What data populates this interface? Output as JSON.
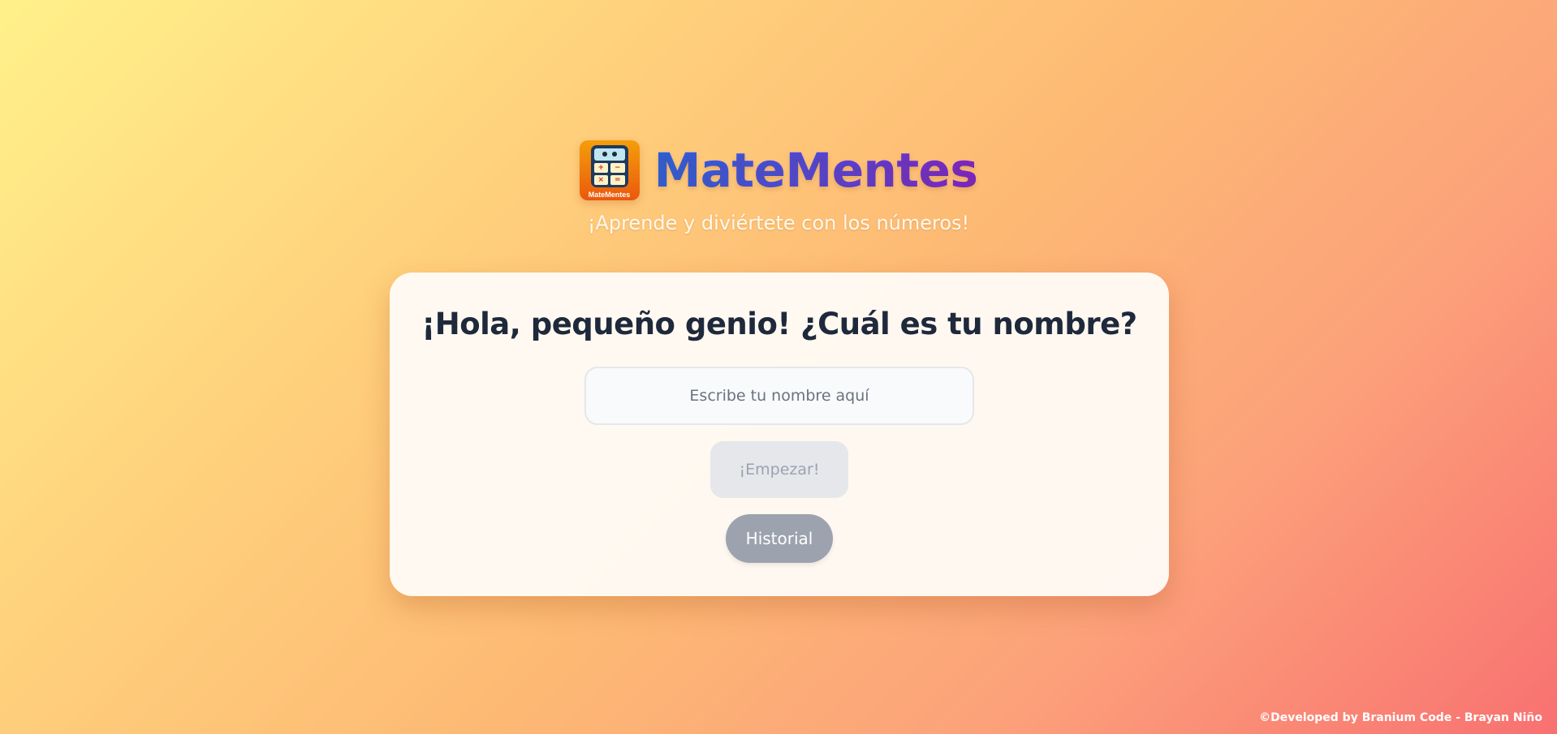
{
  "header": {
    "logo": {
      "icon": "calculator-mascot-icon",
      "caption": "MateMentes",
      "keys": [
        "+",
        "−",
        "×",
        "="
      ]
    },
    "title": "MateMentes",
    "subtitle": "¡Aprende y diviértete con los números!"
  },
  "card": {
    "title": "¡Hola, pequeño genio! ¿Cuál es tu nombre?",
    "name_input": {
      "value": "",
      "placeholder": "Escribe tu nombre aquí"
    },
    "start_label": "¡Empezar!",
    "history_label": "Historial"
  },
  "footer": {
    "text": "©Developed by Branium Code - Brayan Niño"
  },
  "colors": {
    "title_gradient_start": "#2563eb",
    "title_gradient_end": "#7e22ce",
    "heading_text": "#1e293b",
    "disabled_button_bg": "#e5e7eb",
    "history_button_bg": "#9ca3af"
  }
}
